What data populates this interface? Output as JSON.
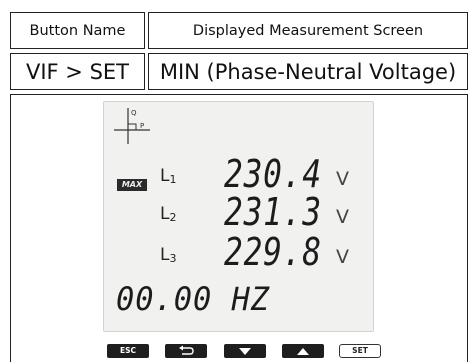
{
  "table": {
    "header": {
      "button_name": "Button Name",
      "displayed_screen": "Displayed Measurement Screen"
    },
    "row": {
      "button_sequence": "VIF > SET",
      "screen_name": "MIN (Phase-Neutral Voltage)"
    }
  },
  "lcd": {
    "axis_labels": {
      "q": "Q",
      "p": "P"
    },
    "badge": "MAX",
    "phases": [
      {
        "label": "L",
        "sub": "1",
        "value": "230.4",
        "unit": "V"
      },
      {
        "label": "L",
        "sub": "2",
        "value": "231.3",
        "unit": "V"
      },
      {
        "label": "L",
        "sub": "3",
        "value": "229.8",
        "unit": "V"
      }
    ],
    "frequency": "00.00 HZ"
  },
  "buttons": {
    "esc": "ESC",
    "back_icon": "back-arrow-icon",
    "down_icon": "triangle-down-icon",
    "up_icon": "triangle-up-icon",
    "set": "SET"
  }
}
